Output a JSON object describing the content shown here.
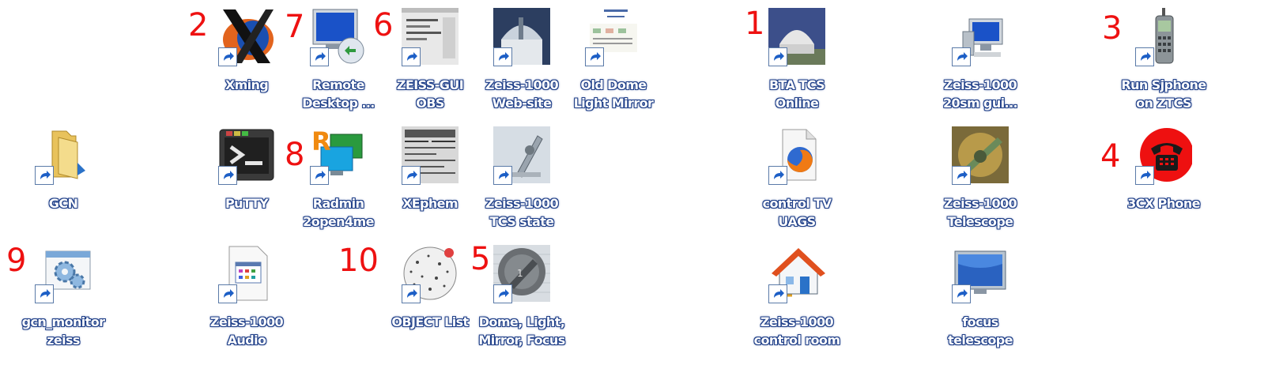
{
  "desktop_icons": [
    {
      "id": "xming",
      "line1": "Xming",
      "line2": ""
    },
    {
      "id": "remote-desktop",
      "line1": "Remote",
      "line2": "Desktop ..."
    },
    {
      "id": "zeiss-gui-obs",
      "line1": "ZEISS-GUI",
      "line2": "OBS"
    },
    {
      "id": "zeiss-web",
      "line1": "Zeiss-1000",
      "line2": "Web-site"
    },
    {
      "id": "old-dome",
      "line1": "Old Dome",
      "line2": "Light Mirror"
    },
    {
      "id": "bta-tcs",
      "line1": "BTA TCS",
      "line2": "Online"
    },
    {
      "id": "zeiss-20sm",
      "line1": "Zeiss-1000",
      "line2": "20sm gui..."
    },
    {
      "id": "sjphone",
      "line1": "Run Sjphone",
      "line2": "on ZTCS"
    },
    {
      "id": "gcn",
      "line1": "GCN",
      "line2": ""
    },
    {
      "id": "putty",
      "line1": "PuTTY",
      "line2": ""
    },
    {
      "id": "radmin",
      "line1": "Radmin",
      "line2": "2open4me"
    },
    {
      "id": "xephem",
      "line1": "XEphem",
      "line2": ""
    },
    {
      "id": "tcs-state",
      "line1": "Zeiss-1000",
      "line2": "TCS state"
    },
    {
      "id": "control-tv",
      "line1": "control TV",
      "line2": "UAGS"
    },
    {
      "id": "zeiss-telescope",
      "line1": "Zeiss-1000",
      "line2": "Telescope"
    },
    {
      "id": "3cx",
      "line1": "3CX Phone",
      "line2": ""
    },
    {
      "id": "gcn-monitor",
      "line1": "gcn_monitor",
      "line2": "zeiss"
    },
    {
      "id": "audio",
      "line1": "Zeiss-1000",
      "line2": "Audio"
    },
    {
      "id": "object-list",
      "line1": "OBJECT List",
      "line2": ""
    },
    {
      "id": "dome-focus",
      "line1": "Dome, Light,",
      "line2": "Mirror, Focus"
    },
    {
      "id": "control-room",
      "line1": "Zeiss-1000",
      "line2": "control room"
    },
    {
      "id": "focus-telescope",
      "line1": "focus",
      "line2": "telescope"
    }
  ],
  "annotations": [
    "1",
    "2",
    "3",
    "4",
    "5",
    "6",
    "7",
    "8",
    "9",
    "10"
  ],
  "colors": {
    "annotation": "#ee1111",
    "label_outline": "#1e3e88",
    "background": "#ffffff"
  }
}
